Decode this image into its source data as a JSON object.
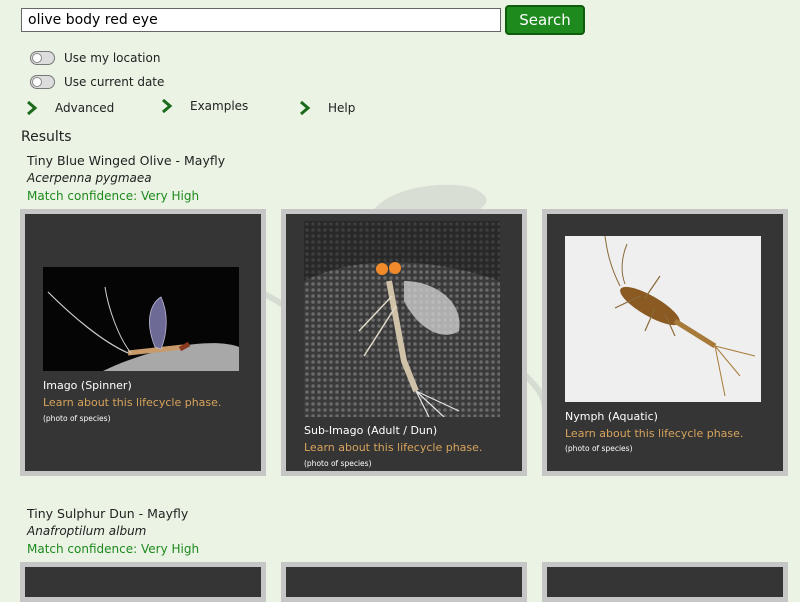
{
  "search": {
    "value": "olive body red eye",
    "button_label": "Search"
  },
  "toggles": [
    {
      "label": "Use my location",
      "on": false
    },
    {
      "label": "Use current date",
      "on": false
    }
  ],
  "expanders": [
    {
      "label": "Advanced"
    },
    {
      "label": "Examples"
    },
    {
      "label": "Help"
    }
  ],
  "results_heading": "Results",
  "species": [
    {
      "name": "Tiny Blue Winged Olive - Mayfly",
      "latin": "Acerpenna pygmaea",
      "confidence": "Match confidence: Very High",
      "cards": [
        {
          "phase": "Imago (Spinner)",
          "link": "Learn about this lifecycle phase.",
          "note": "(photo of species)"
        },
        {
          "phase": "Sub-Imago (Adult / Dun)",
          "link": "Learn about this lifecycle phase.",
          "note": "(photo of species)"
        },
        {
          "phase": "Nymph (Aquatic)",
          "link": "Learn about this lifecycle phase.",
          "note": "(photo of species)"
        }
      ]
    },
    {
      "name": "Tiny Sulphur Dun - Mayfly",
      "latin": "Anafroptilum album",
      "confidence": "Match confidence: Very High"
    }
  ],
  "colors": {
    "background": "#eaf3e4",
    "accent_green": "#1e8a1e",
    "card_bg": "#353535",
    "card_border": "#c6c6c6",
    "link": "#d7a45c"
  },
  "icons": {
    "expander": "chevron-right-icon",
    "toggle": "toggle-switch-icon"
  }
}
